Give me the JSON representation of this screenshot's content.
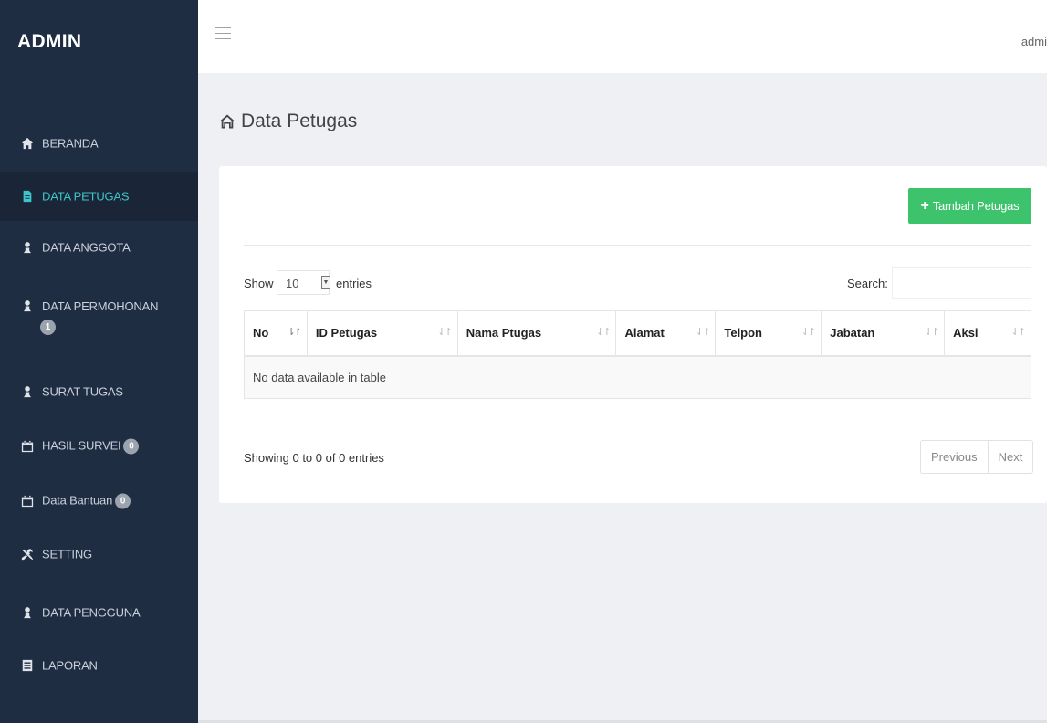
{
  "sidebar": {
    "brand": "ADMIN",
    "items": [
      {
        "label": "BERANDA",
        "icon": "home-icon"
      },
      {
        "label": "DATA PETUGAS",
        "icon": "file-icon",
        "active": true
      },
      {
        "label": "DATA ANGGOTA",
        "icon": "user-icon"
      },
      {
        "label": "DATA PERMOHONAN",
        "icon": "user-icon",
        "badge": "1"
      },
      {
        "label": "SURAT TUGAS",
        "icon": "user-icon"
      },
      {
        "label": "HASIL SURVEI",
        "icon": "calendar-icon",
        "badge": "0"
      },
      {
        "label": "Data Bantuan",
        "icon": "calendar-icon",
        "badge": "0"
      },
      {
        "label": "SETTING",
        "icon": "tools-icon"
      },
      {
        "label": "DATA PENGGUNA",
        "icon": "user-icon"
      },
      {
        "label": "LAPORAN",
        "icon": "list-icon"
      }
    ]
  },
  "topbar": {
    "user": "admi"
  },
  "page": {
    "title": "Data Petugas"
  },
  "card": {
    "add_button": "Tambah Petugas",
    "show_label": "Show",
    "length_value": "10",
    "entries_label": "entries",
    "search_label": "Search:",
    "search_value": "",
    "columns": [
      "No",
      "ID Petugas",
      "Nama Ptugas",
      "Alamat",
      "Telpon",
      "Jabatan",
      "Aksi"
    ],
    "empty_message": "No data available in table",
    "info": "Showing 0 to 0 of 0 entries",
    "pager": {
      "previous": "Previous",
      "next": "Next"
    }
  },
  "colors": {
    "sidebar_bg": "#1f2d42",
    "active_text": "#3fc4c9",
    "add_button_bg": "#3cc36c"
  }
}
